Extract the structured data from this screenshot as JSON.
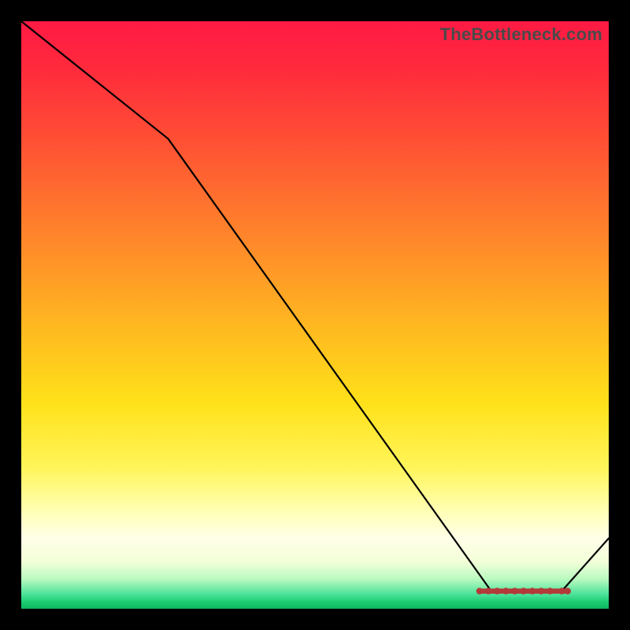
{
  "watermark": "TheBottleneck.com",
  "chart_data": {
    "type": "line",
    "title": "",
    "xlabel": "",
    "ylabel": "",
    "xlim": [
      0,
      100
    ],
    "ylim": [
      0,
      100
    ],
    "series": [
      {
        "name": "curve",
        "x": [
          0,
          25,
          80,
          85,
          92,
          100
        ],
        "y": [
          100,
          80,
          3,
          3,
          3,
          12
        ]
      }
    ],
    "highlight_segment": {
      "name": "bottleneck-region",
      "x": [
        78,
        93
      ],
      "y": [
        3,
        3
      ],
      "dots_x": [
        78,
        79.5,
        81,
        82.5,
        84,
        85.5,
        87,
        88.5,
        90,
        92,
        93
      ],
      "dots_y": [
        3,
        3,
        3,
        3,
        3,
        3,
        3,
        3,
        3,
        3,
        3
      ]
    },
    "background": "rainbow-gradient-vertical"
  }
}
